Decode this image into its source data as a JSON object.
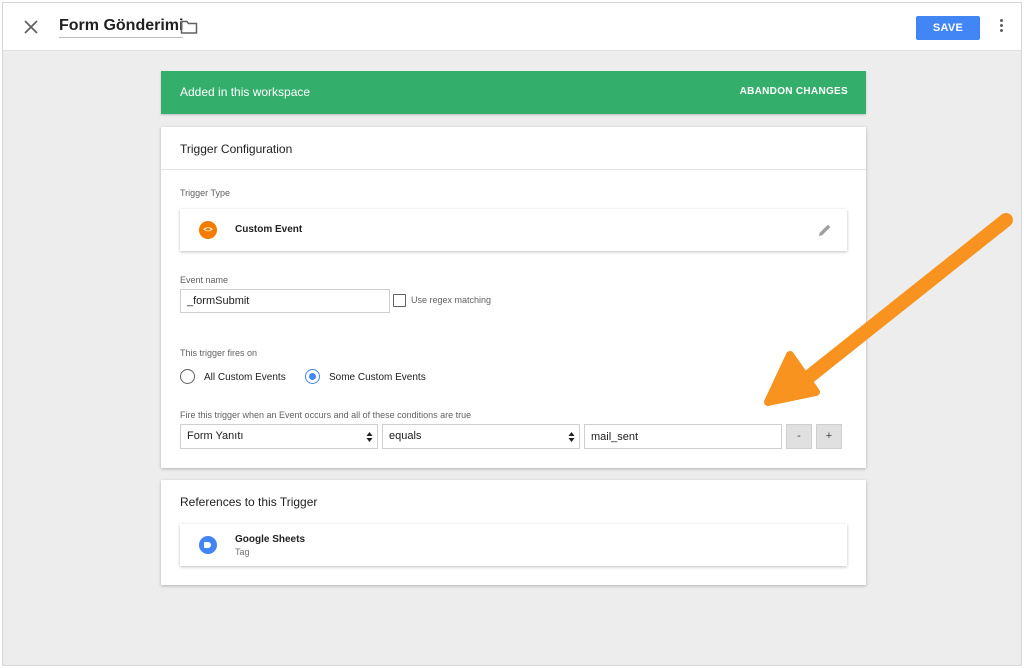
{
  "header": {
    "title": "Form Gönderimi",
    "save_label": "SAVE"
  },
  "banner": {
    "text": "Added in this workspace",
    "abandon_label": "ABANDON CHANGES",
    "color": "#34ae6b"
  },
  "trigger_config": {
    "title": "Trigger Configuration",
    "type_label": "Trigger Type",
    "type_name": "Custom Event",
    "event_name_label": "Event name",
    "event_name_value": "_formSubmit",
    "regex_label": "Use regex matching",
    "regex_checked": false,
    "fires_on_label": "This trigger fires on",
    "radio_all": "All Custom Events",
    "radio_some": "Some Custom Events",
    "selected_option": "Some Custom Events",
    "conditions_label": "Fire this trigger when an Event occurs and all of these conditions are true",
    "condition": {
      "variable": "Form Yanıtı",
      "operator": "equals",
      "value": "mail_sent"
    },
    "remove_label": "-",
    "add_label": "+"
  },
  "references": {
    "title": "References to this Trigger",
    "items": [
      {
        "name": "Google Sheets",
        "kind": "Tag"
      }
    ]
  },
  "colors": {
    "accent": "#4285f4",
    "trigger_icon": "#f57c00",
    "annotation_arrow": "#f7931e"
  }
}
